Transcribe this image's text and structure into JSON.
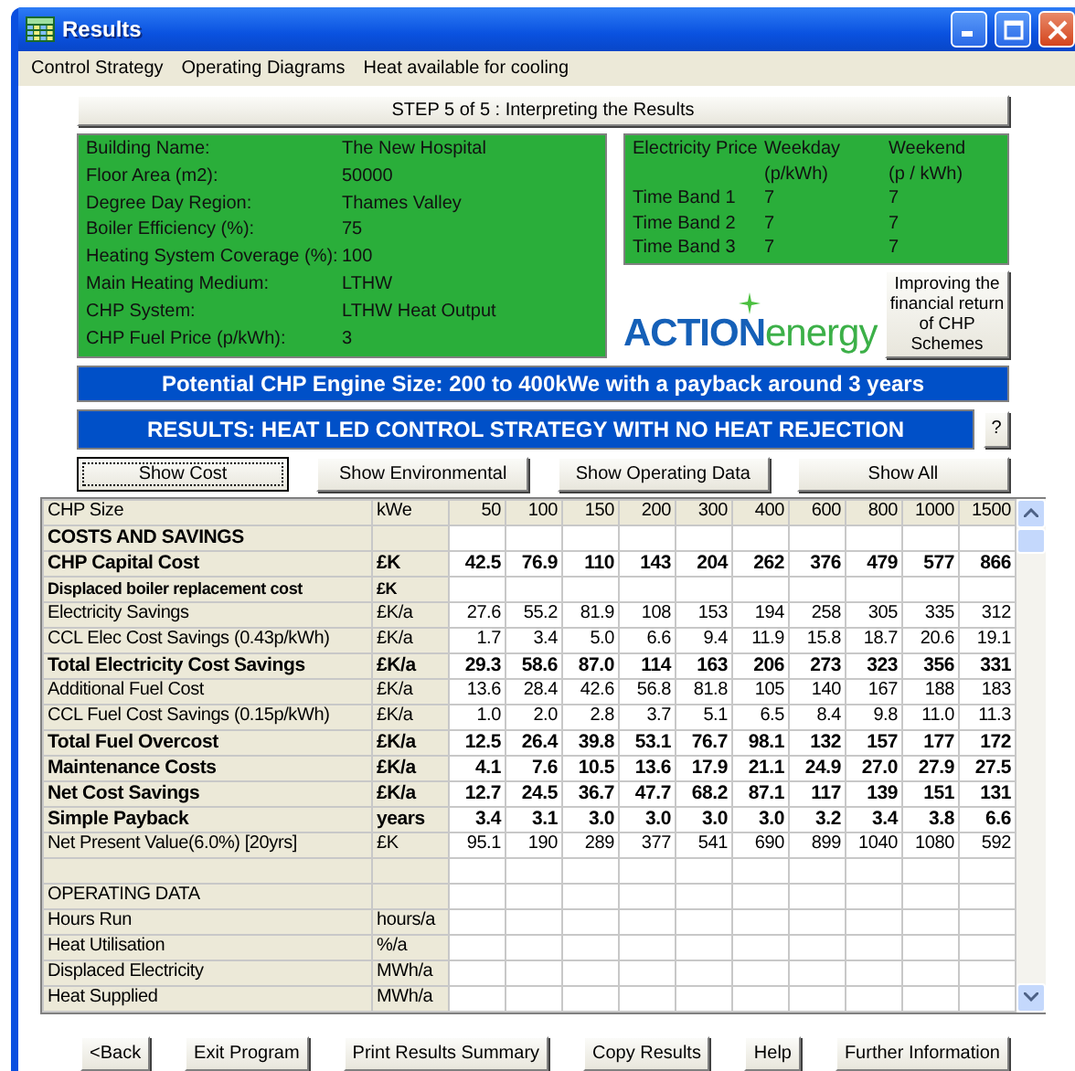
{
  "window": {
    "title": "Results"
  },
  "menu": [
    "Control Strategy",
    "Operating Diagrams",
    "Heat available for cooling"
  ],
  "step_button": {
    "label": "STEP 5 of 5 : Interpreting the Results"
  },
  "building": [
    {
      "label": "Building Name:",
      "value": "The New Hospital"
    },
    {
      "label": "Floor Area (m2):",
      "value": "50000"
    },
    {
      "label": "Degree Day Region:",
      "value": "Thames Valley"
    },
    {
      "label": "Boiler Efficiency (%):",
      "value": "75"
    },
    {
      "label": "Heating System Coverage (%):",
      "value": "100"
    },
    {
      "label": "Main Heating Medium:",
      "value": "LTHW"
    },
    {
      "label": "CHP System:",
      "value": "LTHW Heat Output"
    },
    {
      "label": "CHP Fuel Price (p/kWh):",
      "value": "3"
    }
  ],
  "electricity_price": {
    "title": "Electricity Price",
    "columns": [
      [
        "Weekday",
        "(p/kWh)"
      ],
      [
        "Weekend",
        "(p / kWh)"
      ]
    ],
    "rows": [
      {
        "band": "Time Band 1",
        "weekday": "7",
        "weekend": "7"
      },
      {
        "band": "Time Band 2",
        "weekday": "7",
        "weekend": "7"
      },
      {
        "band": "Time Band 3",
        "weekday": "7",
        "weekend": "7"
      }
    ]
  },
  "logo": {
    "strong": "ACTION",
    "light": "energy"
  },
  "improving_button": {
    "label": "Improving the financial return of CHP Schemes"
  },
  "potential_banner": "Potential CHP Engine Size:  200 to  400kWe with a payback around 3 years",
  "results_banner": "RESULTS: HEAT LED CONTROL STRATEGY WITH NO HEAT REJECTION",
  "help_button": "?",
  "view_buttons": [
    {
      "label": "Show Cost",
      "focused": true
    },
    {
      "label": "Show Environmental",
      "focused": false
    },
    {
      "label": "Show Operating Data",
      "focused": false
    },
    {
      "label": "Show All",
      "focused": false
    }
  ],
  "table": {
    "rows": [
      {
        "kind": "header",
        "label": "CHP Size",
        "unit": "kWe",
        "values": [
          "50",
          "100",
          "150",
          "200",
          "300",
          "400",
          "600",
          "800",
          "1000",
          "1500"
        ]
      },
      {
        "kind": "section",
        "label": "COSTS AND SAVINGS"
      },
      {
        "kind": "bold",
        "label": "CHP Capital Cost",
        "unit": "£K",
        "values": [
          "42.5",
          "76.9",
          "110",
          "143",
          "204",
          "262",
          "376",
          "479",
          "577",
          "866"
        ]
      },
      {
        "kind": "small-bold",
        "label": "Displaced boiler replacement cost",
        "unit": "£K"
      },
      {
        "kind": "normal",
        "label": "Electricity Savings",
        "unit": "£K/a",
        "values": [
          "27.6",
          "55.2",
          "81.9",
          "108",
          "153",
          "194",
          "258",
          "305",
          "335",
          "312"
        ]
      },
      {
        "kind": "normal",
        "label": "CCL Elec Cost Savings (0.43p/kWh)",
        "unit": "£K/a",
        "values": [
          "1.7",
          "3.4",
          "5.0",
          "6.6",
          "9.4",
          "11.9",
          "15.8",
          "18.7",
          "20.6",
          "19.1"
        ]
      },
      {
        "kind": "bold",
        "label": "Total Electricity Cost Savings",
        "unit": "£K/a",
        "values": [
          "29.3",
          "58.6",
          "87.0",
          "114",
          "163",
          "206",
          "273",
          "323",
          "356",
          "331"
        ]
      },
      {
        "kind": "normal",
        "label": "Additional Fuel Cost",
        "unit": "£K/a",
        "values": [
          "13.6",
          "28.4",
          "42.6",
          "56.8",
          "81.8",
          "105",
          "140",
          "167",
          "188",
          "183"
        ]
      },
      {
        "kind": "normal",
        "label": "CCL Fuel Cost Savings (0.15p/kWh)",
        "unit": "£K/a",
        "values": [
          "1.0",
          "2.0",
          "2.8",
          "3.7",
          "5.1",
          "6.5",
          "8.4",
          "9.8",
          "11.0",
          "11.3"
        ]
      },
      {
        "kind": "bold",
        "label": "Total Fuel Overcost",
        "unit": "£K/a",
        "values": [
          "12.5",
          "26.4",
          "39.8",
          "53.1",
          "76.7",
          "98.1",
          "132",
          "157",
          "177",
          "172"
        ]
      },
      {
        "kind": "bold",
        "label": "Maintenance Costs",
        "unit": "£K/a",
        "values": [
          "4.1",
          "7.6",
          "10.5",
          "13.6",
          "17.9",
          "21.1",
          "24.9",
          "27.0",
          "27.9",
          "27.5"
        ]
      },
      {
        "kind": "bold",
        "label": "Net Cost Savings",
        "unit": "£K/a",
        "values": [
          "12.7",
          "24.5",
          "36.7",
          "47.7",
          "68.2",
          "87.1",
          "117",
          "139",
          "151",
          "131"
        ]
      },
      {
        "kind": "bold",
        "label": "Simple Payback",
        "unit": "years",
        "values": [
          "3.4",
          "3.1",
          "3.0",
          "3.0",
          "3.0",
          "3.0",
          "3.2",
          "3.4",
          "3.8",
          "6.6"
        ]
      },
      {
        "kind": "normal",
        "label": "Net Present Value(6.0%) [20yrs]",
        "unit": "£K",
        "values": [
          "95.1",
          "190",
          "289",
          "377",
          "541",
          "690",
          "899",
          "1040",
          "1080",
          "592"
        ]
      },
      {
        "kind": "blank"
      },
      {
        "kind": "normal",
        "label": "OPERATING DATA"
      },
      {
        "kind": "normal",
        "label": "Hours Run",
        "unit": "hours/a"
      },
      {
        "kind": "normal",
        "label": "Heat Utilisation",
        "unit": "%/a"
      },
      {
        "kind": "normal",
        "label": "Displaced Electricity",
        "unit": "MWh/a"
      },
      {
        "kind": "normal",
        "label": "Heat Supplied",
        "unit": "MWh/a"
      }
    ]
  },
  "footer_buttons": [
    {
      "label": "<Back"
    },
    {
      "label": "Exit Program"
    },
    {
      "label": "Print Results Summary"
    },
    {
      "label": "Copy Results"
    },
    {
      "label": "Help"
    },
    {
      "label": "Further Information"
    }
  ]
}
